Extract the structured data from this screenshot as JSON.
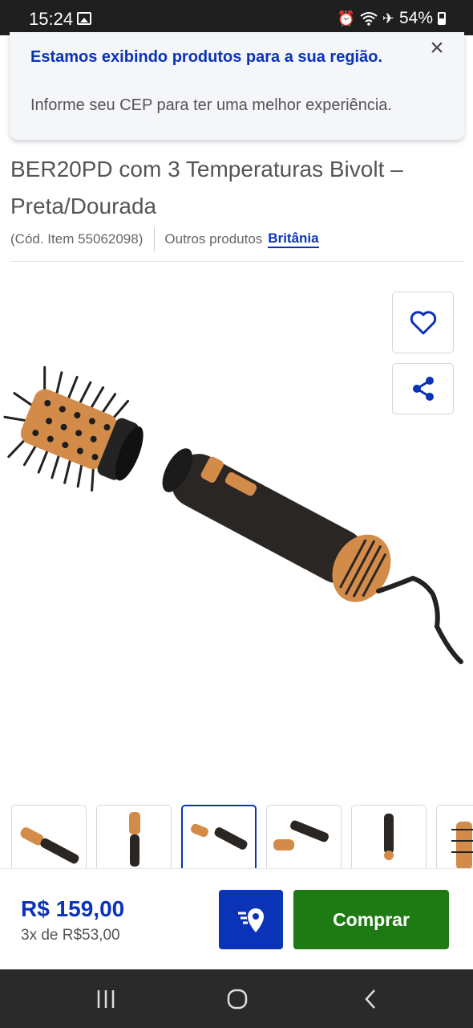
{
  "status_bar": {
    "time": "15:24",
    "battery": "54%",
    "icons": [
      "image-icon",
      "alarm-icon",
      "wifi-icon",
      "airplane-icon",
      "battery-icon"
    ]
  },
  "region_banner": {
    "title": "Estamos exibindo produtos para a sua região.",
    "subtitle": "Informe seu CEP para ter uma melhor experiência."
  },
  "product": {
    "title": "BER20PD com 3 Temperaturas Bivolt – Preta/Dourada",
    "code": "(Cód. Item 55062098)",
    "others_label": "Outros produtos",
    "brand": "Britânia",
    "thumbnails": [
      "thumb-1",
      "thumb-2",
      "thumb-3",
      "thumb-4",
      "thumb-5",
      "thumb-6"
    ],
    "active_thumbnail": 3
  },
  "purchase": {
    "price": "R$ 159,00",
    "installments": "3x de R$53,00",
    "buy_label": "Comprar"
  },
  "colors": {
    "accent": "#0a33b8",
    "buy": "#1e7b14",
    "gold": "#d38b4a"
  }
}
